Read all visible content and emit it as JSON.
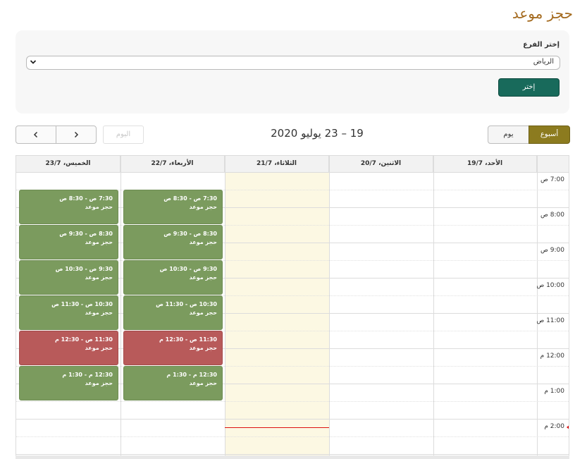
{
  "page": {
    "title": "حجز موعد"
  },
  "branch": {
    "label": "إختر الفرع",
    "selected": "الرياض",
    "choose_button": "إختر"
  },
  "toolbar": {
    "prev_icon": "chevron-left-icon",
    "next_icon": "chevron-right-icon",
    "today": "اليوم",
    "range": "19 – 23 يوليو 2020",
    "view_day": "يوم",
    "view_week": "أسبوع"
  },
  "calendar": {
    "days": [
      "الخميس، 23/7",
      "الأربعاء، 22/7",
      "الثلاثاء، 21/7",
      "الاثنين، 20/7",
      "الأحد، 19/7"
    ],
    "times": [
      "7:00 ص",
      "8:00 ص",
      "9:00 ص",
      "10:00 ص",
      "11:00 ص",
      "12:00 م",
      "1:00 م",
      "2:00 م"
    ],
    "event_title": "حجز موعد",
    "wed_events": [
      {
        "time": "7:30 ص - 8:30 ص",
        "title": "حجز موعد",
        "status": "available"
      },
      {
        "time": "8:30 ص - 9:30 ص",
        "title": "حجز موعد",
        "status": "available"
      },
      {
        "time": "9:30 ص - 10:30 ص",
        "title": "حجز موعد",
        "status": "available"
      },
      {
        "time": "10:30 ص - 11:30 ص",
        "title": "حجز موعد",
        "status": "available"
      },
      {
        "time": "11:30 ص - 12:30 م",
        "title": "حجز موعد",
        "status": "booked"
      },
      {
        "time": "12:30 م - 1:30 م",
        "title": "حجز موعد",
        "status": "available"
      }
    ],
    "thu_events": [
      {
        "time": "7:30 ص - 8:30 ص",
        "title": "حجز موعد",
        "status": "available"
      },
      {
        "time": "8:30 ص - 9:30 ص",
        "title": "حجز موعد",
        "status": "available"
      },
      {
        "time": "9:30 ص - 10:30 ص",
        "title": "حجز موعد",
        "status": "available"
      },
      {
        "time": "10:30 ص - 11:30 ص",
        "title": "حجز موعد",
        "status": "available"
      },
      {
        "time": "11:30 ص - 12:30 م",
        "title": "حجز موعد",
        "status": "booked"
      },
      {
        "time": "12:30 م - 1:30 م",
        "title": "حجز موعد",
        "status": "available"
      }
    ]
  },
  "colors": {
    "title": "#a46a1e",
    "primary_button": "#186a5b",
    "week_button": "#8c7b1f",
    "available": "#7b9b5e",
    "booked": "#b85a5a",
    "today_bg": "#fcf8e3",
    "now_line": "#dd1111"
  }
}
